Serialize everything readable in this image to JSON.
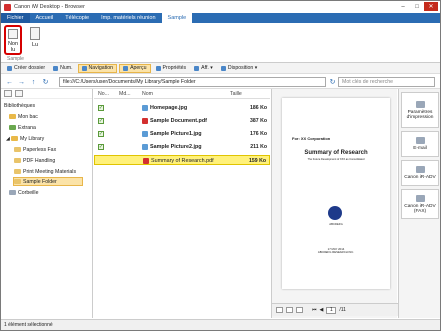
{
  "window": {
    "title": "Canon iW Desktop - Browser"
  },
  "ribbon_tabs": [
    "Fichier",
    "Accueil",
    "Télécopie",
    "Imp. matériels réunion",
    "Sample"
  ],
  "ribbon": {
    "buttons": [
      {
        "label": "Non lu",
        "selected": true
      },
      {
        "label": "Lu",
        "selected": false
      }
    ],
    "group_label": "Sample"
  },
  "toolbar": {
    "items": [
      "Créer dossier",
      "Num.",
      "Navigation",
      "Aperçu",
      "Propriétés",
      "Aff.",
      "Disposition"
    ]
  },
  "address": {
    "path": "file:///C:/Users/user/Documents/My Library/Sample Folder",
    "search_placeholder": "Mot clés de recherche"
  },
  "tree": {
    "header": "Bibliothèques",
    "items": [
      "Mon bac",
      "Extrana",
      "My Library",
      "Paperless Fax",
      "PDF Handling",
      "Print Meeting Materials",
      "Sample Folder",
      "Corbeille"
    ]
  },
  "file_columns": {
    "no": "No...",
    "md": "Md...",
    "name": "Nom",
    "size": "Taille"
  },
  "files": [
    {
      "name": "Homepage.jpg",
      "size": "186 Ko",
      "type": "jpg"
    },
    {
      "name": "Sample Document.pdf",
      "size": "387 Ko",
      "type": "pdf"
    },
    {
      "name": "Sample Picture1.jpg",
      "size": "176 Ko",
      "type": "jpg"
    },
    {
      "name": "Sample Picture2.jpg",
      "size": "211 Ko",
      "type": "jpg"
    },
    {
      "name": "Summary of Research.pdf",
      "size": "159 Ko",
      "type": "pdf",
      "selected": true
    }
  ],
  "preview": {
    "corp": "For: XX Corporation",
    "title": "Summary of Research",
    "subtitle": "The Future Development of XXX as Consolidated",
    "logo_text": "ABCDEFG",
    "footer": [
      "17 MAY 2014",
      "ABCDEFG RESEARCH INC."
    ],
    "page_current": "1",
    "page_total": "/11"
  },
  "right_panel": [
    "Paramètres d'impression",
    "E-mail",
    "Canon iR-ADV",
    "Canon iR-ADV (FAX)"
  ],
  "status": "1 élément sélectionné",
  "colors": {
    "ribbon_blue": "#2b6cb3",
    "selection_yellow": "#fff17a",
    "highlight_red": "#d50000"
  }
}
